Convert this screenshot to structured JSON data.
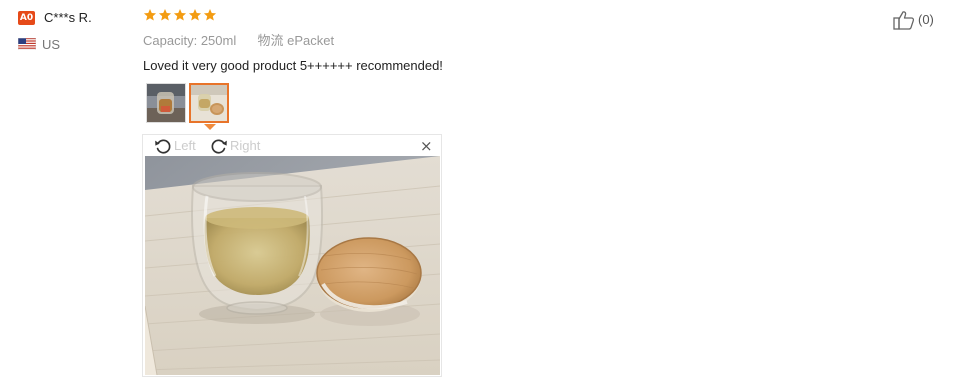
{
  "reviewer": {
    "badge": "A0",
    "name": "C***s R.",
    "country": "US",
    "flag_icon": "us-flag-icon"
  },
  "review": {
    "rating": 5,
    "star_color": "#f39c12",
    "attributes": [
      {
        "label": "Capacity:",
        "value": "250ml"
      },
      {
        "label": "物流",
        "value": "ePacket"
      }
    ],
    "text": "Loved it very good product 5++++++ recommended!",
    "thumbnails": [
      {
        "name": "review-photo-1",
        "selected": false
      },
      {
        "name": "review-photo-2",
        "selected": true
      }
    ]
  },
  "viewer": {
    "rotate_left_label": "Left",
    "rotate_right_label": "Right",
    "close_label": "×",
    "image_icon": "glass-cup-with-bamboo-lid-photo"
  },
  "helpful": {
    "count_label": "(0)",
    "icon": "thumbs-up-icon"
  },
  "colors": {
    "accent": "#e8742a",
    "badge": "#e64a19",
    "muted_text": "#999999"
  }
}
